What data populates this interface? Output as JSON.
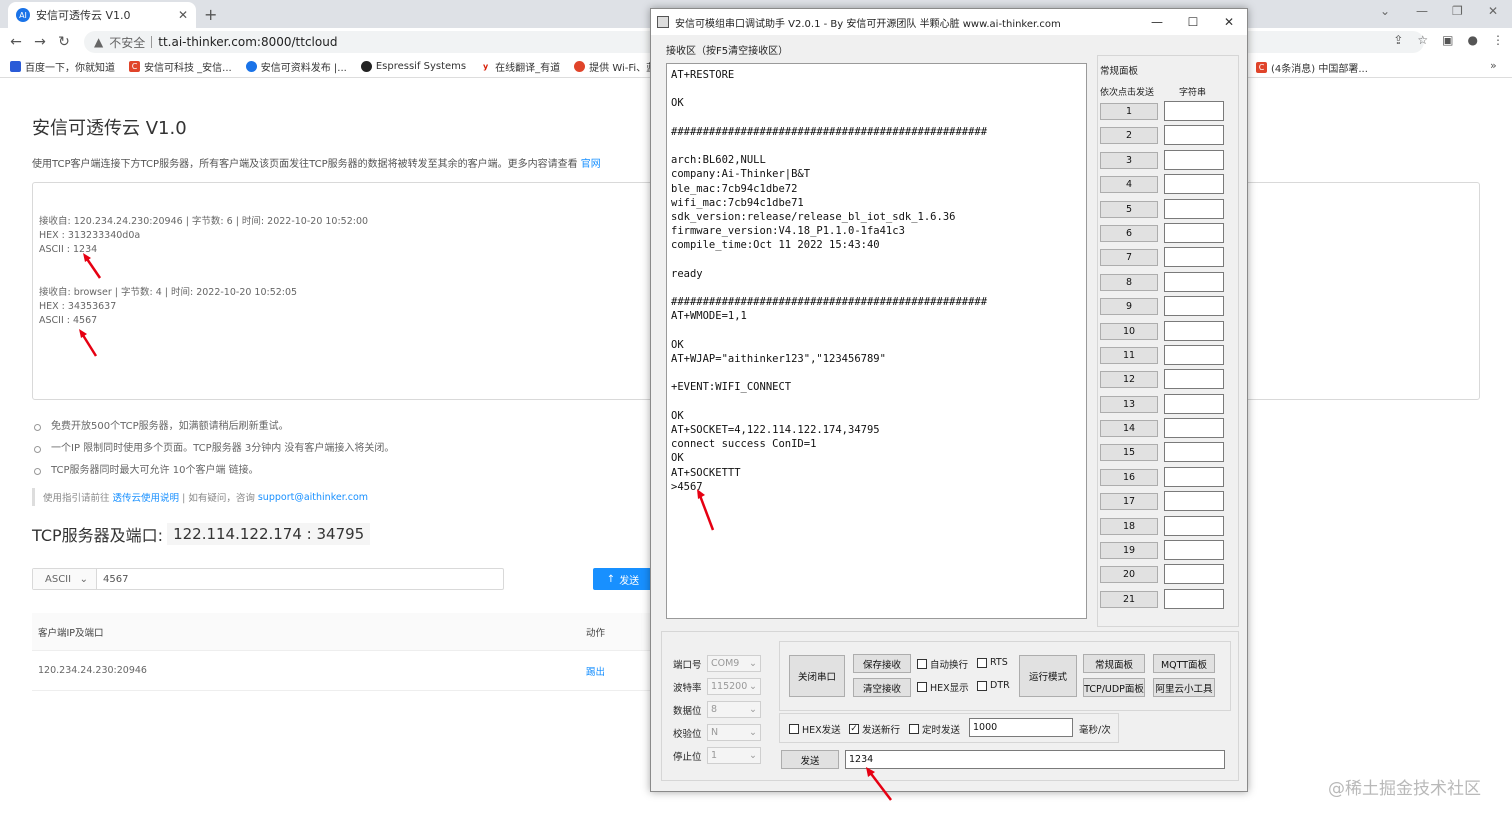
{
  "browser": {
    "tab_title": "安信可透传云 V1.0",
    "tab_icon": "AI",
    "url_warning": "不安全",
    "url": "tt.ai-thinker.com:8000/ttcloud",
    "bookmarks": [
      {
        "label": "百度一下，你就知道",
        "color": "#2a5bd7",
        "icon": "paw-icon"
      },
      {
        "label": "安信可科技 _安信...",
        "color": "#e0442a",
        "icon": "c-icon"
      },
      {
        "label": "安信可资料发布 |...",
        "color": "#1a73e8",
        "icon": "ai-icon"
      },
      {
        "label": "Espressif Systems",
        "color": "#222222",
        "icon": "github-icon"
      },
      {
        "label": "在线翻译_有道",
        "color": "#d81e06",
        "icon": "youdao-icon"
      },
      {
        "label": "提供 Wi-Fi、蓝牙...",
        "color": "#e0442a",
        "icon": "espressif-icon"
      }
    ],
    "bookmark_right": "(4条消息) 中国部署...",
    "bookmark_right_color": "#e0442a"
  },
  "page": {
    "title": "安信可透传云 V1.0",
    "desc": "使用TCP客户端连接下方TCP服务器，所有客户端及该页面发往TCP服务器的数据将被转发至其余的客户端。更多内容请查看",
    "desc_link": "官网",
    "messages": [
      {
        "line1": "接收自: 120.234.24.230:20946 | 字节数: 6 | 时间: 2022-10-20 10:52:00",
        "line2": "HEX  : 313233340d0a",
        "line3": "ASCII : 1234"
      },
      {
        "line1": "接收自: browser | 字节数: 4 | 时间: 2022-10-20 10:52:05",
        "line2": "HEX  : 34353637",
        "line3": "ASCII : 4567"
      }
    ],
    "bullets": [
      "免费开放500个TCP服务器，如满额请稍后刷新重试。",
      "一个IP 限制同时使用多个页面。TCP服务器 3分钟内 没有客户端接入将关闭。",
      "TCP服务器同时最大可允许 10个客户端 链接。"
    ],
    "hint_prefix": "使用指引请前往",
    "hint_link": "透传云使用说明",
    "hint_mid": "| 如有疑问，咨询",
    "hint_email": "support@aithinker.com",
    "server_label": "TCP服务器及端口:",
    "server_addr": "122.114.122.174 : 34795",
    "send_mode": "ASCII",
    "send_value": "4567",
    "send_button": "发送",
    "table_headers": [
      "客户端IP及端口",
      "动作"
    ],
    "table_rows": [
      {
        "client": "120.234.24.230:20946",
        "action": "踢出"
      }
    ]
  },
  "serial": {
    "title": "安信可模组串口调试助手 V2.0.1 - By 安信可开源团队 半颗心脏 www.ai-thinker.com",
    "recv_label": "接收区（按F5清空接收区）",
    "recv_text": "AT+RESTORE\n\nOK\n\n##################################################\n\narch:BL602,NULL\ncompany:Ai-Thinker|B&T\nble_mac:7cb94c1dbe72\nwifi_mac:7cb94c1dbe71\nsdk_version:release/release_bl_iot_sdk_1.6.36\nfirmware_version:V4.18_P1.1.0-1fa41c3\ncompile_time:Oct 11 2022 15:43:40\n\nready\n\n##################################################\nAT+WMODE=1,1\n\nOK\nAT+WJAP=\"aithinker123\",\"123456789\"\n\n+EVENT:WIFI_CONNECT\n\nOK\nAT+SOCKET=4,122.114.122.174,34795\nconnect success ConID=1\nOK\nAT+SOCKETTT\n>4567",
    "panel_title": "常规面板",
    "col_send": "依次点击发送",
    "col_str": "字符串",
    "panel_rows": [
      "1",
      "2",
      "3",
      "4",
      "5",
      "6",
      "7",
      "8",
      "9",
      "10",
      "11",
      "12",
      "13",
      "14",
      "15",
      "16",
      "17",
      "18",
      "19",
      "20",
      "21"
    ],
    "config": [
      {
        "label": "端口号",
        "value": "COM9"
      },
      {
        "label": "波特率",
        "value": "115200"
      },
      {
        "label": "数据位",
        "value": "8"
      },
      {
        "label": "校验位",
        "value": "N"
      },
      {
        "label": "停止位",
        "value": "1"
      }
    ],
    "close_port": "关闭串口",
    "save_recv": "保存接收",
    "clear_recv": "清空接收",
    "auto_wrap": "自动换行",
    "hex_show": "HEX显示",
    "rts": "RTS",
    "dtr": "DTR",
    "run_mode": "运行模式",
    "normal_panel": "常规面板",
    "mqtt_panel": "MQTT面板",
    "tcpudp_panel": "TCP/UDP面板",
    "aliyun_tool": "阿里云小工具",
    "hex_send": "HEX发送",
    "send_newline": "发送新行",
    "timed_send": "定时发送",
    "interval": "1000",
    "interval_unit": "毫秒/次",
    "send_button": "发送",
    "send_text": "1234"
  },
  "watermark": "@稀土掘金技术社区"
}
